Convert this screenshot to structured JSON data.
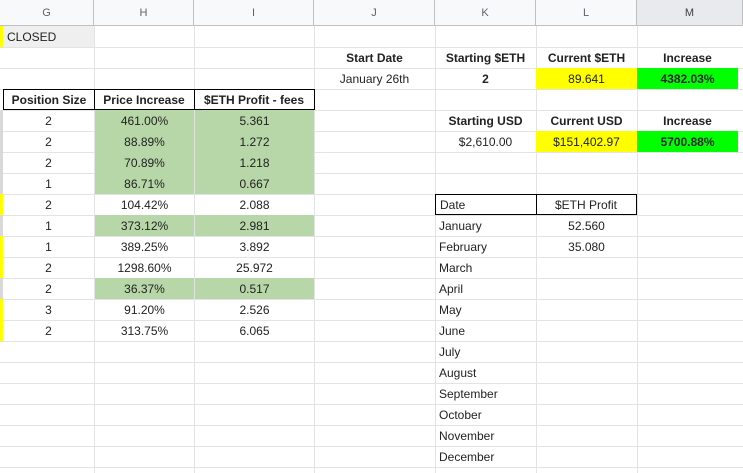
{
  "column_headers": [
    "G",
    "H",
    "I",
    "J",
    "K",
    "L",
    "M"
  ],
  "status_label": "CLOSED",
  "summary": {
    "start_date_label": "Start Date",
    "start_date_value": "January 26th",
    "starting_eth_label": "Starting $ETH",
    "starting_eth_value": "2",
    "current_eth_label": "Current $ETH",
    "current_eth_value": "89.641",
    "eth_increase_label": "Increase",
    "eth_increase_value": "4382.03%",
    "starting_usd_label": "Starting USD",
    "starting_usd_value": "$2,610.00",
    "current_usd_label": "Current USD",
    "current_usd_value": "$151,402.97",
    "usd_increase_label": "Increase",
    "usd_increase_value": "5700.88%"
  },
  "positions_table": {
    "headers": [
      "Position Size",
      "Price Increase",
      "$ETH Profit - fees"
    ],
    "rows": [
      {
        "size": "2",
        "increase": "461.00%",
        "profit": "5.361",
        "highlight": true
      },
      {
        "size": "2",
        "increase": "88.89%",
        "profit": "1.272",
        "highlight": true
      },
      {
        "size": "2",
        "increase": "70.89%",
        "profit": "1.218",
        "highlight": true
      },
      {
        "size": "1",
        "increase": "86.71%",
        "profit": "0.667",
        "highlight": true
      },
      {
        "size": "2",
        "increase": "104.42%",
        "profit": "2.088",
        "highlight": false
      },
      {
        "size": "1",
        "increase": "373.12%",
        "profit": "2.981",
        "highlight": true
      },
      {
        "size": "1",
        "increase": "389.25%",
        "profit": "3.892",
        "highlight": false
      },
      {
        "size": "2",
        "increase": "1298.60%",
        "profit": "25.972",
        "highlight": false
      },
      {
        "size": "2",
        "increase": "36.37%",
        "profit": "0.517",
        "highlight": true
      },
      {
        "size": "3",
        "increase": "91.20%",
        "profit": "2.526",
        "highlight": false
      },
      {
        "size": "2",
        "increase": "313.75%",
        "profit": "6.065",
        "highlight": false
      }
    ]
  },
  "monthly_table": {
    "headers": [
      "Date",
      "$ETH Profit"
    ],
    "rows": [
      {
        "month": "January",
        "profit": "52.560"
      },
      {
        "month": "February",
        "profit": "35.080"
      },
      {
        "month": "March",
        "profit": ""
      },
      {
        "month": "April",
        "profit": ""
      },
      {
        "month": "May",
        "profit": ""
      },
      {
        "month": "June",
        "profit": ""
      },
      {
        "month": "July",
        "profit": ""
      },
      {
        "month": "August",
        "profit": ""
      },
      {
        "month": "September",
        "profit": ""
      },
      {
        "month": "October",
        "profit": ""
      },
      {
        "month": "November",
        "profit": ""
      },
      {
        "month": "December",
        "profit": ""
      }
    ]
  },
  "colors": {
    "profit_green": "#b7d7a8",
    "highlight_yellow": "#ffff00",
    "increase_green": "#00ff00"
  }
}
